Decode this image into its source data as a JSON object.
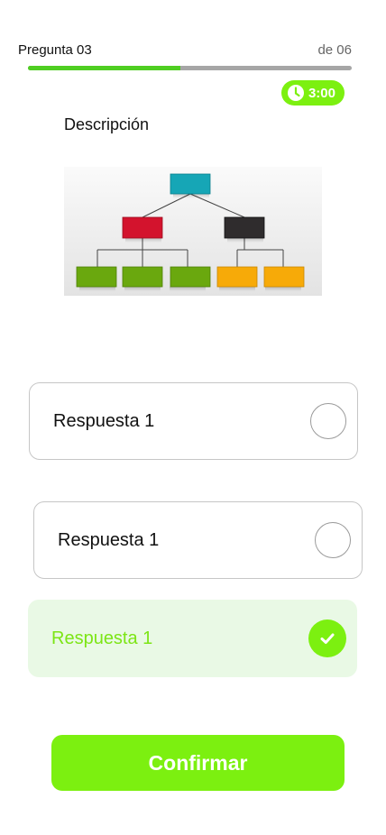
{
  "header": {
    "question_label": "Pregunta 03",
    "question_total": "de 06",
    "progress": 0.47
  },
  "timer": {
    "icon": "clock-icon",
    "value": "3:00"
  },
  "question": {
    "description": "Descripción"
  },
  "answers": [
    {
      "label": "Respuesta 1",
      "selected": false
    },
    {
      "label": "Respuesta 1",
      "selected": false
    },
    {
      "label": "Respuesta 1",
      "selected": true
    }
  ],
  "confirm_label": "Confirmar",
  "colors": {
    "accent": "#7cf010",
    "progress": "#4fce22",
    "selected_bg": "#e9f9e5",
    "selected_text": "#7ce515"
  }
}
